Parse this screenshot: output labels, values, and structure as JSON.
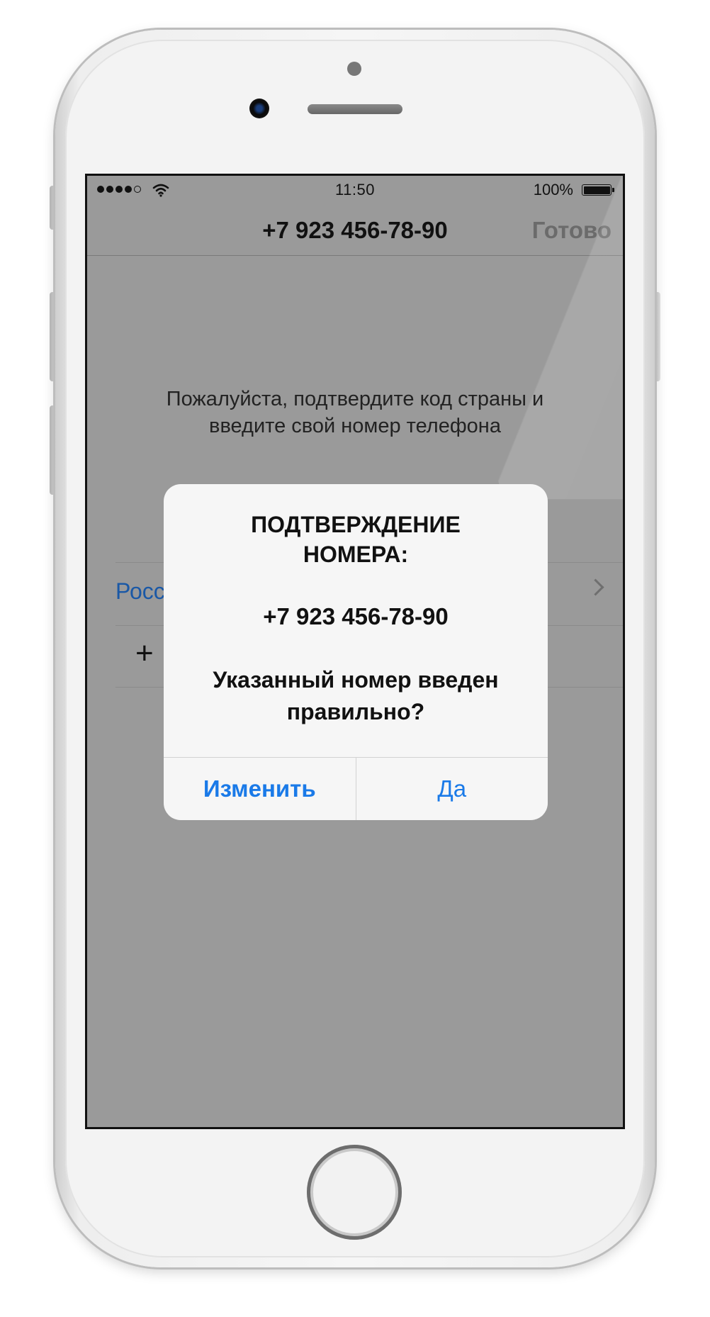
{
  "status_bar": {
    "signal_bars": 4,
    "signal_max": 5,
    "time": "11:50",
    "battery_percent": "100%",
    "battery_level": 1.0
  },
  "nav": {
    "title": "+7 923 456-78-90",
    "done_label": "Готово"
  },
  "instruction": {
    "line1": "Пожалуйста, подтвердите код страны и",
    "line2": "введите свой номер телефона"
  },
  "country_row": {
    "visible_text": "Росс"
  },
  "phone_row": {
    "prefix_visible": "+"
  },
  "alert": {
    "title_line1": "ПОДТВЕРЖДЕНИЕ",
    "title_line2": "НОМЕРА:",
    "number": "+7 923 456-78-90",
    "question_line1": "Указанный номер введен",
    "question_line2": "правильно?",
    "edit_label": "Изменить",
    "confirm_label": "Да"
  },
  "colors": {
    "accent_blue": "#1a7ae8",
    "dim_overlay": "#9a9a9a",
    "alert_bg": "#f6f6f6"
  }
}
